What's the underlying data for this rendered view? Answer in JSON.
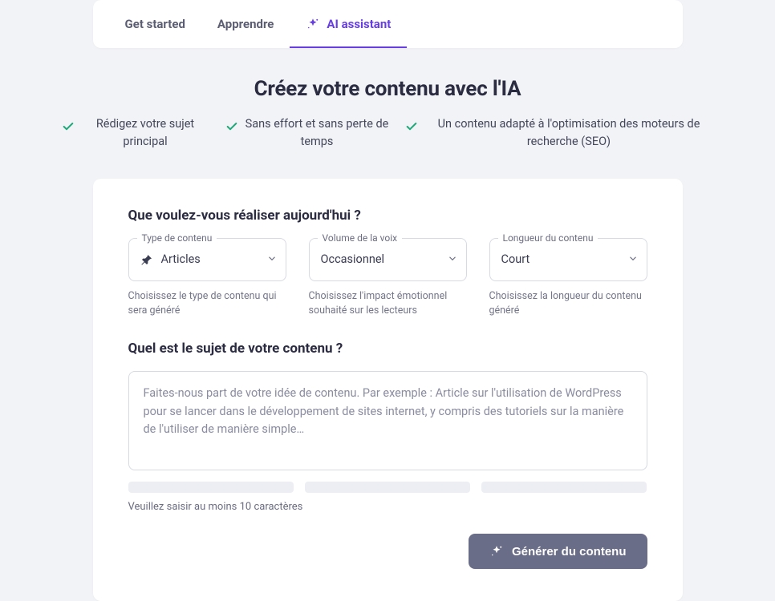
{
  "tabs": [
    {
      "label": "Get started"
    },
    {
      "label": "Apprendre"
    },
    {
      "label": "AI assistant"
    }
  ],
  "activeTab": 2,
  "hero": {
    "title": "Créez votre contenu avec l'IA",
    "benefits": [
      "Rédigez votre sujet principal",
      "Sans effort et sans perte de temps",
      "Un contenu adapté à l'optimisation des moteurs de recherche (SEO)"
    ]
  },
  "form": {
    "q1": "Que voulez-vous réaliser aujourd'hui ?",
    "controls": {
      "contentType": {
        "float": "Type de contenu",
        "value": "Articles",
        "help": "Choisissez le type de contenu qui sera généré"
      },
      "voice": {
        "float": "Volume de la voix",
        "value": "Occasionnel",
        "help": "Choisissez l'impact émotionnel souhaité sur les lecteurs"
      },
      "length": {
        "float": "Longueur du contenu",
        "value": "Court",
        "help": "Choisissez la longueur du contenu généré"
      }
    },
    "q2": "Quel est le sujet de votre contenu ?",
    "topic": {
      "value": "",
      "placeholder": "Faites-nous part de votre idée de contenu. Par exemple : Article sur l'utilisation de WordPress pour se lancer dans le développement de sites internet, y compris des tutoriels sur la manière de l'utiliser de manière simple…"
    },
    "hint": "Veuillez saisir au moins 10 caractères",
    "submit": "Générer du contenu"
  }
}
